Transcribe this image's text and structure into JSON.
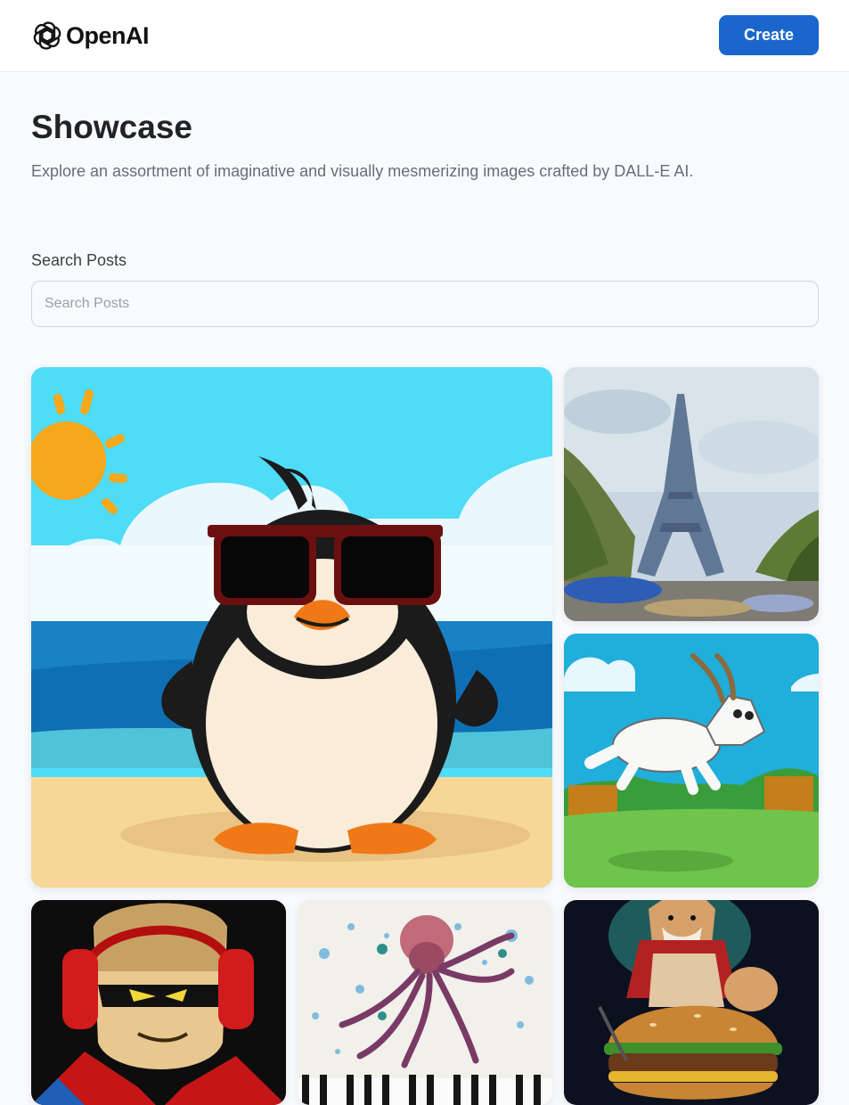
{
  "header": {
    "logo_text": "OpenAI",
    "create_label": "Create"
  },
  "hero": {
    "title": "Showcase",
    "subtitle": "Explore an assortment of imaginative and visually mesmerizing images crafted by DALL-E AI."
  },
  "search": {
    "label": "Search Posts",
    "placeholder": "Search Posts",
    "value": ""
  },
  "colors": {
    "accent": "#1a66cc",
    "background": "#f9fafe"
  },
  "gallery": {
    "items": [
      {
        "subject": "penguin-sunglasses-beach"
      },
      {
        "subject": "eiffel-tower-impressionist"
      },
      {
        "subject": "goat-jumping-cartoon"
      },
      {
        "subject": "masked-character-headphones"
      },
      {
        "subject": "octopus-piano-watercolor"
      },
      {
        "subject": "shiba-burger-painting"
      }
    ]
  }
}
